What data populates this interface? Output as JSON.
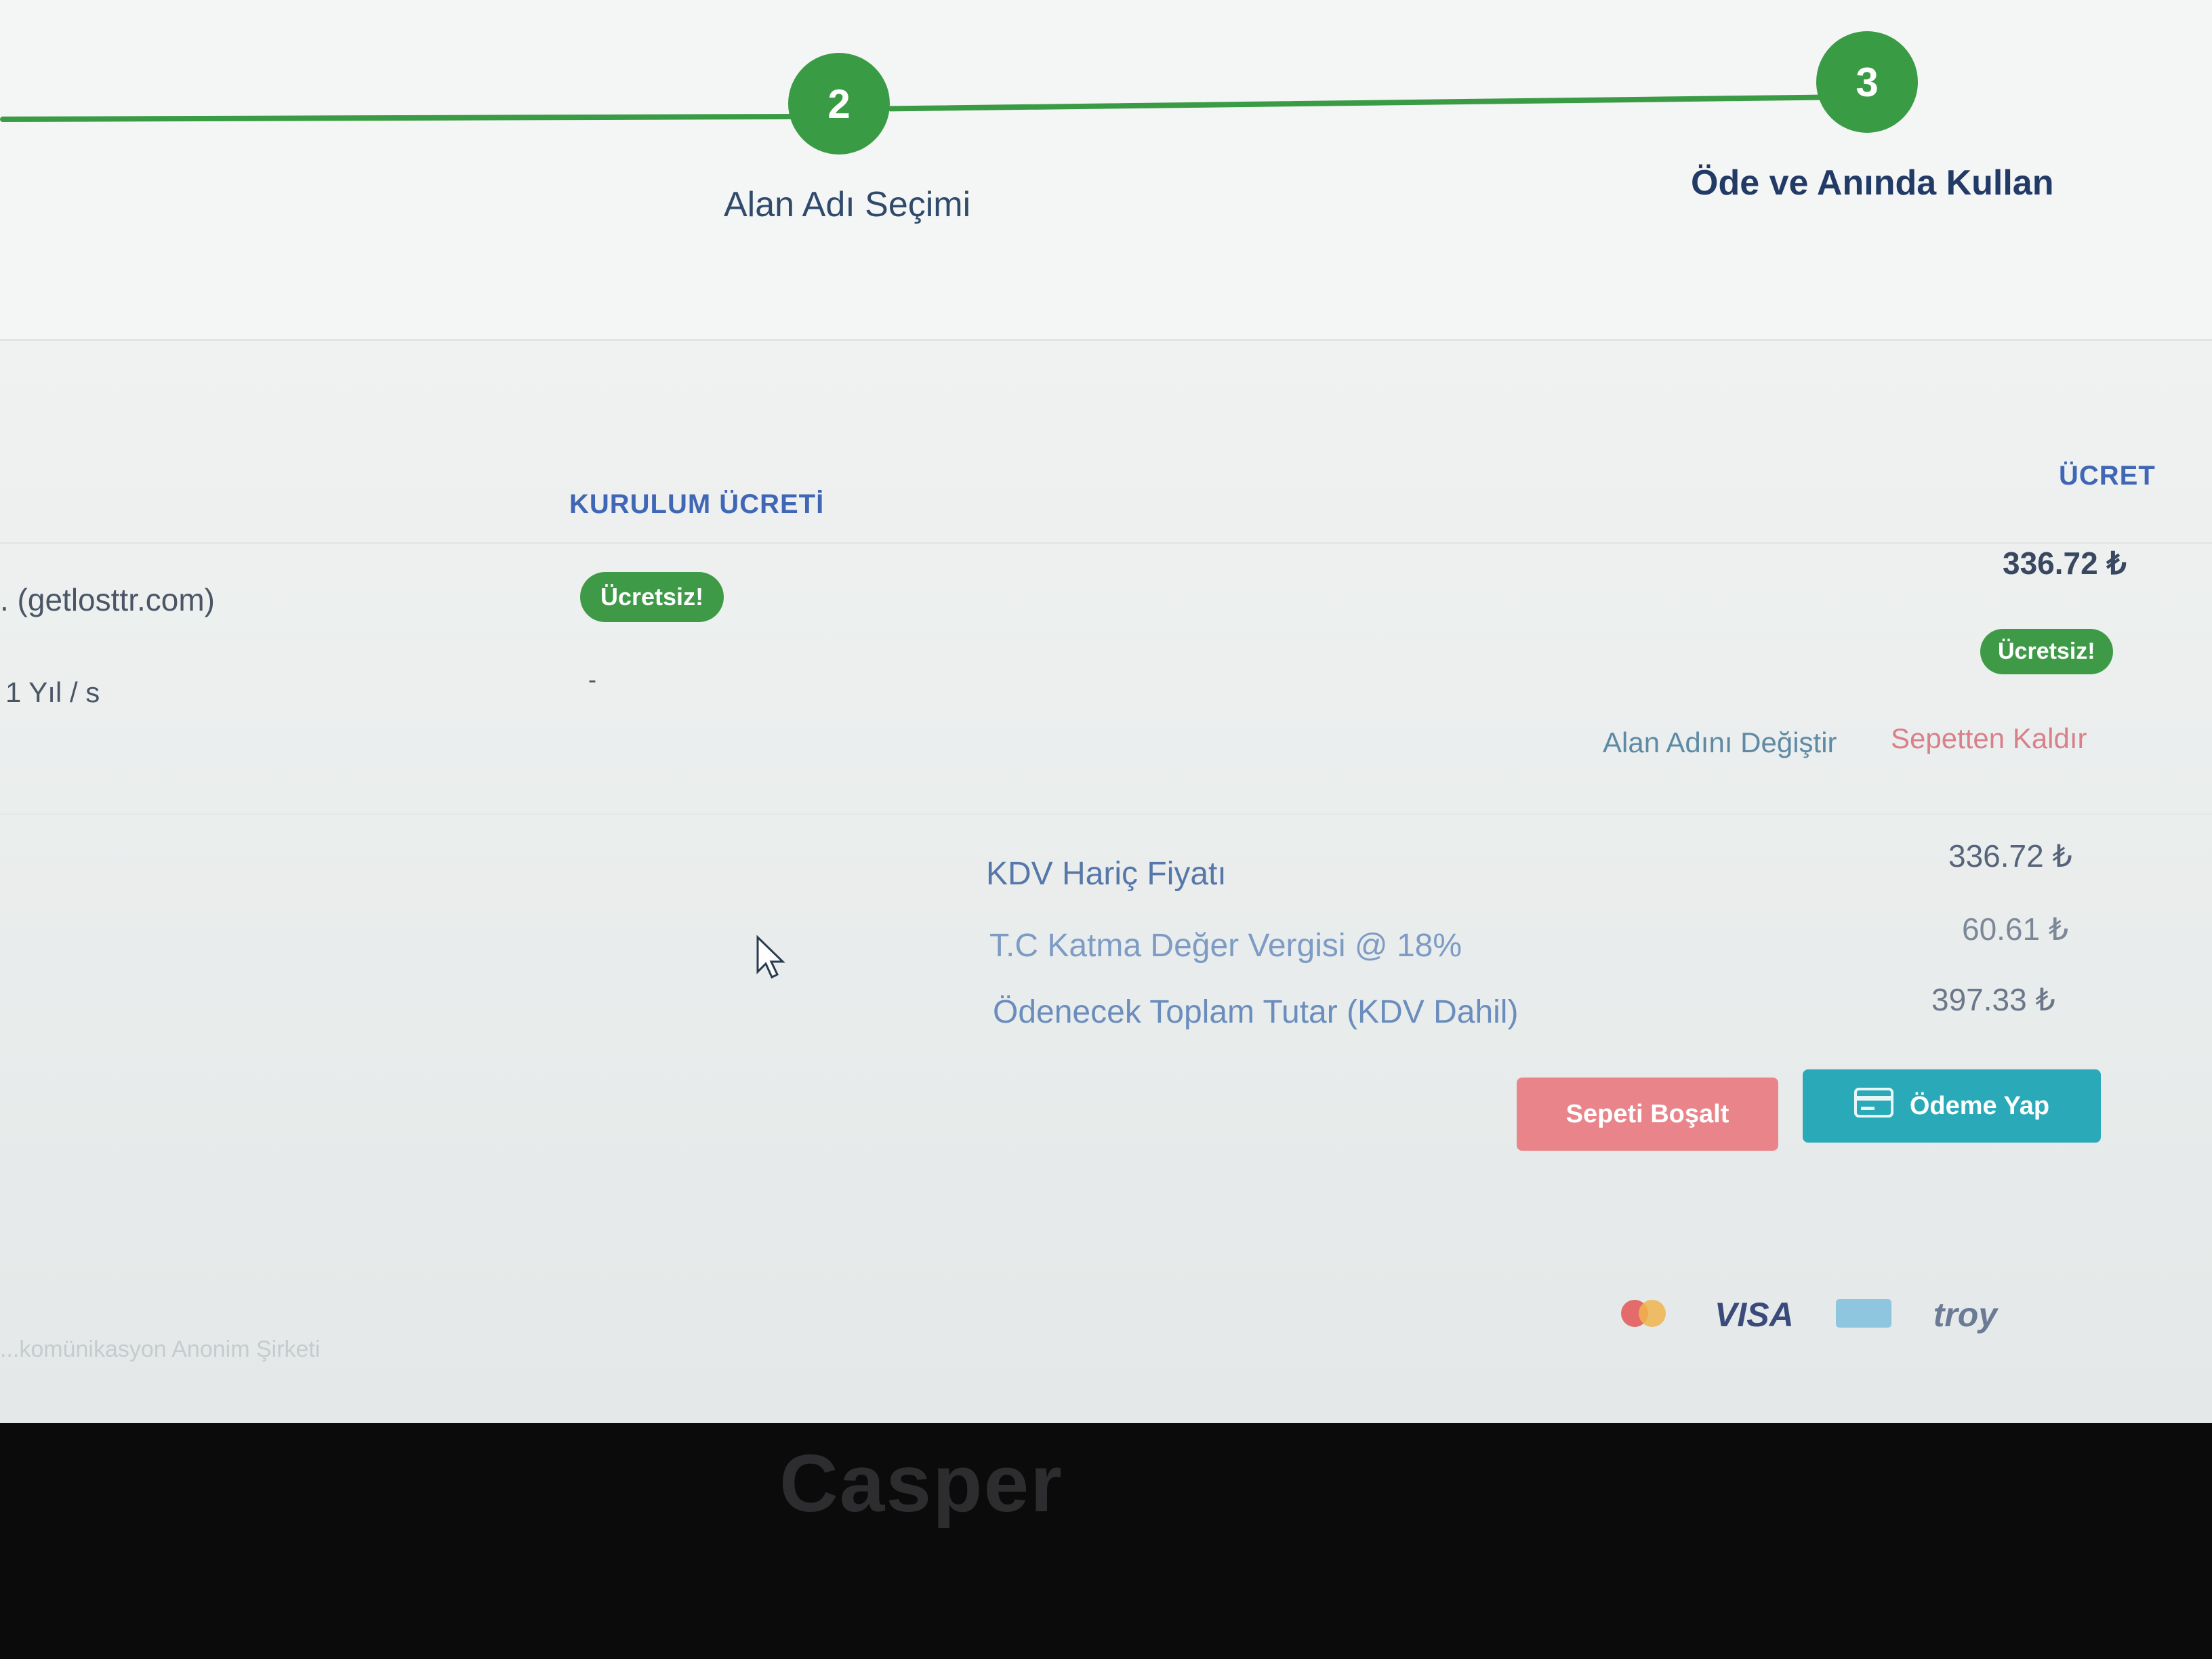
{
  "steps": {
    "step2": {
      "number": "2",
      "label": "Alan Adı Seçimi"
    },
    "step3": {
      "number": "3",
      "label": "Öde ve Anında Kullan"
    }
  },
  "table": {
    "headers": {
      "setup_fee": "KURULUM ÜCRETİ",
      "price": "ÜCRET"
    },
    "row": {
      "domain": ". (getlosttr.com)",
      "period": "1 Yıl / s",
      "setup_badge": "Ücretsiz!",
      "setup_dash": "-",
      "price": "336.72 ₺",
      "price_badge": "Ücretsiz!"
    },
    "actions": {
      "change_domain": "Alan Adını Değiştir",
      "remove": "Sepetten Kaldır"
    }
  },
  "summary": {
    "subtotal_label": "KDV Hariç Fiyatı",
    "subtotal_value": "336.72 ₺",
    "vat_label": "T.C Katma Değer Vergisi @ 18%",
    "vat_value": "60.61 ₺",
    "total_label": "Ödenecek Toplam Tutar (KDV Dahil)",
    "total_value": "397.33 ₺"
  },
  "buttons": {
    "empty_cart": "Sepeti Boşalt",
    "pay": "Ödeme Yap"
  },
  "payments": {
    "visa": "VISA",
    "troy": "troy"
  },
  "footer": {
    "company": "...komünikasyon Anonim Şirketi"
  },
  "bezel": {
    "brand": "Casper"
  },
  "colors": {
    "accent_green": "#3a9b45",
    "danger": "#e06b73",
    "info": "#2aa9b8"
  }
}
